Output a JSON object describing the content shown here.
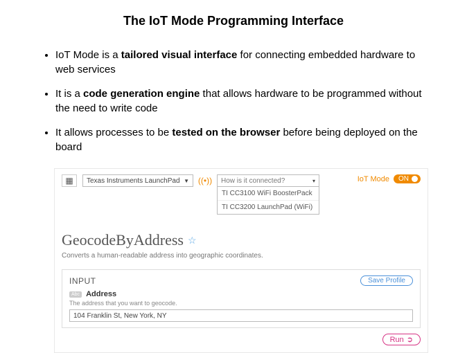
{
  "title": "The IoT Mode Programming Interface",
  "bullets": [
    {
      "pre": "IoT Mode is a ",
      "bold": "tailored visual interface",
      "post": " for connecting embedded hardware to web services"
    },
    {
      "pre": "It is a ",
      "bold": "code generation engine",
      "post": " that allows hardware to be programmed without the need to write code"
    },
    {
      "pre": "It allows processes to be ",
      "bold": "tested on the browser",
      "post": " before being deployed on the board"
    }
  ],
  "iot": {
    "device_selected": "Texas Instruments LaunchPad",
    "connection_placeholder": "How is it connected?",
    "connection_options": [
      "TI CC3100 WiFi BoosterPack",
      "TI CC3200 LaunchPad (WiFi)"
    ],
    "mode_label": "IoT Mode",
    "toggle_text": "ON",
    "service_title": "GeocodeByAddress",
    "service_desc": "Converts a human-readable address into geographic coordinates.",
    "input_heading": "INPUT",
    "save_profile": "Save Profile",
    "field_tag": "Abc",
    "field_label": "Address",
    "field_desc": "The address that you want to geocode.",
    "field_value": "104 Franklin St, New York, NY",
    "run_label": "Run"
  }
}
